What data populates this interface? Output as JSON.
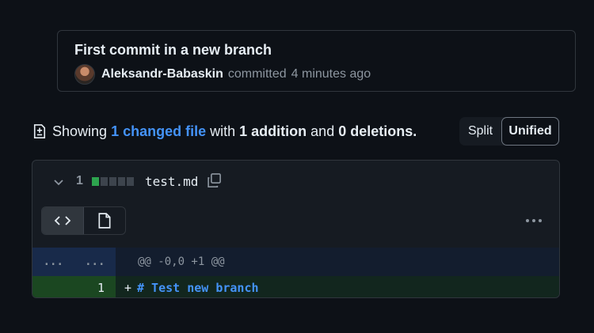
{
  "commit": {
    "title": "First commit in a new branch",
    "author": "Aleksandr-Babaskin",
    "action": "committed",
    "time": "4 minutes ago"
  },
  "summary": {
    "prefix": "Showing",
    "changed_files": "1 changed file",
    "with": "with",
    "additions": "1 addition",
    "and": "and",
    "deletions": "0 deletions",
    "period": "."
  },
  "view_toggle": {
    "split_label": "Split",
    "unified_label": "Unified",
    "selected": "Unified"
  },
  "file": {
    "change_count": "1",
    "diffstat": [
      "add",
      "neutral",
      "neutral",
      "neutral",
      "neutral"
    ],
    "name": "test.md",
    "hunk_left": "...",
    "hunk_right": "...",
    "hunk_header": "@@ -0,0 +1 @@",
    "lines": [
      {
        "new_number": "1",
        "sign": "+",
        "text": "# Test new branch"
      }
    ]
  },
  "colors": {
    "accent": "#4493f8",
    "addition": "#2da44e",
    "background": "#0d1117"
  }
}
